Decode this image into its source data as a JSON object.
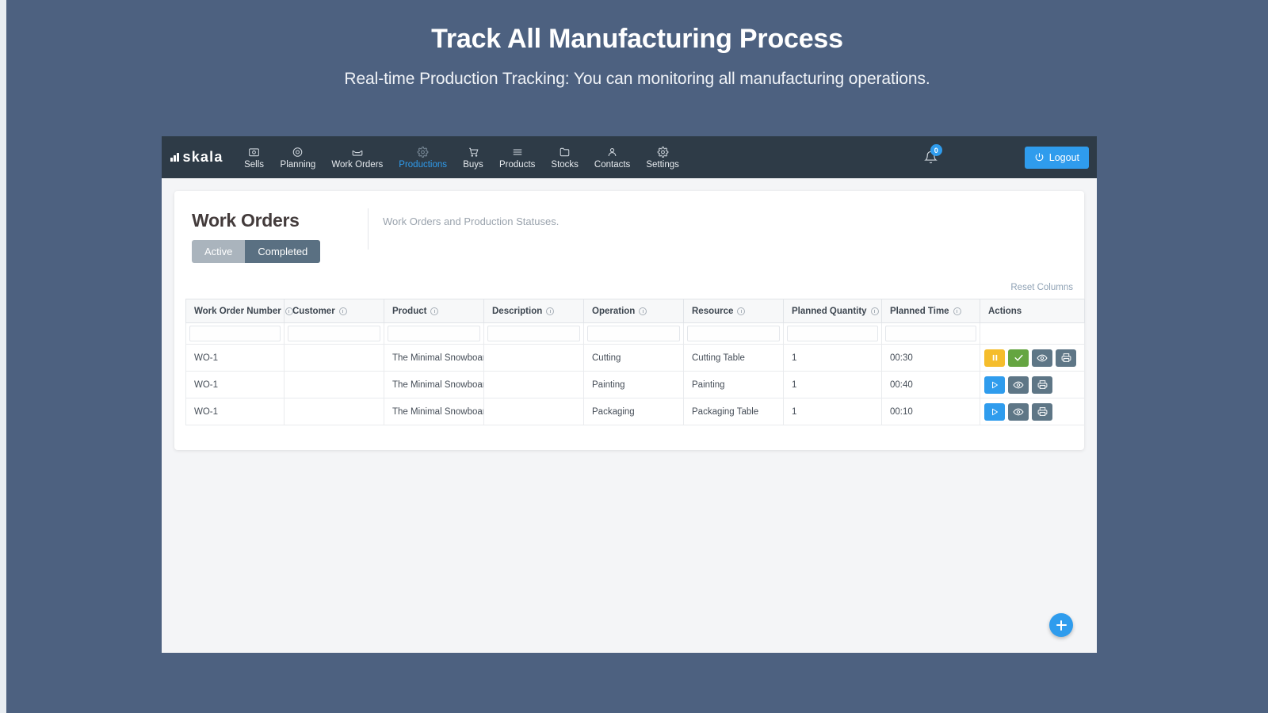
{
  "hero": {
    "title": "Track All Manufacturing Process",
    "subtitle": "Real-time Production Tracking: You can monitoring all manufacturing operations."
  },
  "nav": {
    "logo": "skala",
    "items": [
      {
        "label": "Sells",
        "icon": "camera-icon",
        "active": false
      },
      {
        "label": "Planning",
        "icon": "eye-icon",
        "active": false
      },
      {
        "label": "Work Orders",
        "icon": "inbox-icon",
        "active": false
      },
      {
        "label": "Productions",
        "icon": "gear-icon",
        "active": true
      },
      {
        "label": "Buys",
        "icon": "cart-icon",
        "active": false
      },
      {
        "label": "Products",
        "icon": "list-icon",
        "active": false
      },
      {
        "label": "Stocks",
        "icon": "folder-icon",
        "active": false
      },
      {
        "label": "Contacts",
        "icon": "user-icon",
        "active": false
      },
      {
        "label": "Settings",
        "icon": "gear-icon",
        "active": false
      }
    ],
    "notification_count": "0",
    "logout_label": "Logout"
  },
  "page": {
    "title": "Work Orders",
    "subtitle": "Work Orders and Production Statuses.",
    "tabs": [
      {
        "label": "Active",
        "selected": true
      },
      {
        "label": "Completed",
        "selected": false
      }
    ],
    "reset_columns_label": "Reset Columns"
  },
  "table": {
    "columns": [
      {
        "label": "Work Order Number",
        "info": true
      },
      {
        "label": "Customer",
        "info": true
      },
      {
        "label": "Product",
        "info": true
      },
      {
        "label": "Description",
        "info": true
      },
      {
        "label": "Operation",
        "info": true
      },
      {
        "label": "Resource",
        "info": true
      },
      {
        "label": "Planned Quantity",
        "info": true
      },
      {
        "label": "Planned Time",
        "info": true
      },
      {
        "label": "Actions",
        "info": false
      }
    ],
    "filter_placeholder": "",
    "rows": [
      {
        "work_order_number": "WO-1",
        "customer": "",
        "product": "The Minimal Snowboard",
        "description": "",
        "operation": "Cutting",
        "resource": "Cutting Table",
        "planned_quantity": "1",
        "planned_time": "00:30",
        "actions": [
          "pause-icon",
          "check-icon",
          "eye-icon",
          "print-icon"
        ]
      },
      {
        "work_order_number": "WO-1",
        "customer": "",
        "product": "The Minimal Snowboard",
        "description": "",
        "operation": "Painting",
        "resource": "Painting",
        "planned_quantity": "1",
        "planned_time": "00:40",
        "actions": [
          "play-icon",
          "eye-icon",
          "print-icon"
        ]
      },
      {
        "work_order_number": "WO-1",
        "customer": "",
        "product": "The Minimal Snowboard",
        "description": "",
        "operation": "Packaging",
        "resource": "Packaging Table",
        "planned_quantity": "1",
        "planned_time": "00:10",
        "actions": [
          "play-icon",
          "eye-icon",
          "print-icon"
        ]
      }
    ]
  },
  "fab": {
    "icon": "plus-icon"
  },
  "colors": {
    "hero_bg": "#4d6180",
    "nav_bg": "#2e3b47",
    "accent": "#2f9ced",
    "tab_active": "#aab4bd",
    "tab_inactive": "#5a7082",
    "pause": "#f5bd2c",
    "check": "#65a541",
    "slate": "#5e7686"
  }
}
